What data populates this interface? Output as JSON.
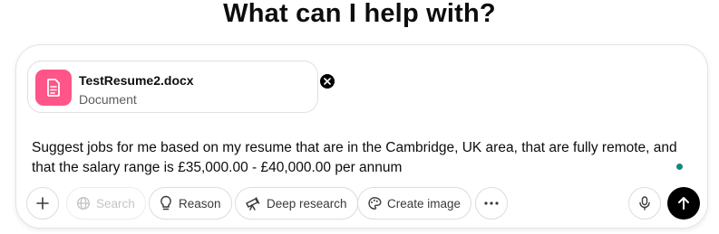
{
  "heading": "What can I help with?",
  "attachment": {
    "file_name": "TestResume2.docx",
    "file_type": "Document",
    "icon": "document-icon",
    "icon_color": "#ff5588"
  },
  "prompt": {
    "text": "Suggest jobs for me based on my resume that are in the Cambridge, UK area, that are fully remote, and that the salary range is £35,000.00 - £40,000.00 per annum"
  },
  "toolbar": {
    "add_icon": "plus-icon",
    "search_label": "Search",
    "search_icon": "globe-icon",
    "reason_label": "Reason",
    "reason_icon": "lightbulb-icon",
    "deep_research_label": "Deep research",
    "deep_research_icon": "telescope-icon",
    "create_image_label": "Create image",
    "create_image_icon": "palette-icon",
    "more_icon": "more-horizontal-icon",
    "mic_icon": "microphone-icon",
    "send_icon": "arrow-up-icon"
  },
  "colors": {
    "accent_pink": "#ff5588",
    "status_dot": "#128a7a",
    "send_button": "#000000"
  }
}
